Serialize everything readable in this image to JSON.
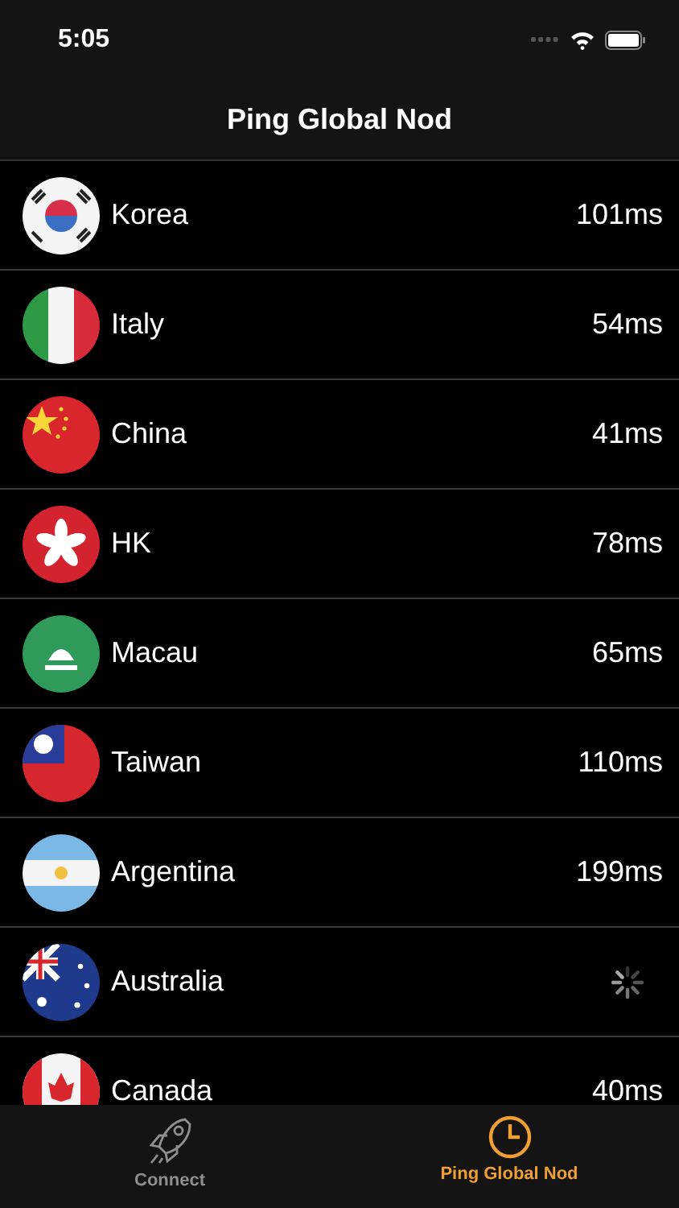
{
  "status_bar": {
    "time": "5:05"
  },
  "nav_bar": {
    "title": "Ping Global Nod"
  },
  "nodes": [
    {
      "name": "Korea",
      "kind": "result",
      "ping": "101ms"
    },
    {
      "name": "Italy",
      "kind": "result",
      "ping": "54ms"
    },
    {
      "name": "China",
      "kind": "result",
      "ping": "41ms"
    },
    {
      "name": "HK",
      "kind": "result",
      "ping": "78ms"
    },
    {
      "name": "Macau",
      "kind": "result",
      "ping": "65ms"
    },
    {
      "name": "Taiwan",
      "kind": "result",
      "ping": "110ms"
    },
    {
      "name": "Argentina",
      "kind": "result",
      "ping": "199ms"
    },
    {
      "name": "Australia",
      "kind": "loading"
    },
    {
      "name": "Canada",
      "kind": "result",
      "ping": "40ms"
    }
  ],
  "tabs": [
    {
      "label": "Connect",
      "selected": false
    },
    {
      "label": "Ping Global Nod",
      "selected": true
    }
  ]
}
